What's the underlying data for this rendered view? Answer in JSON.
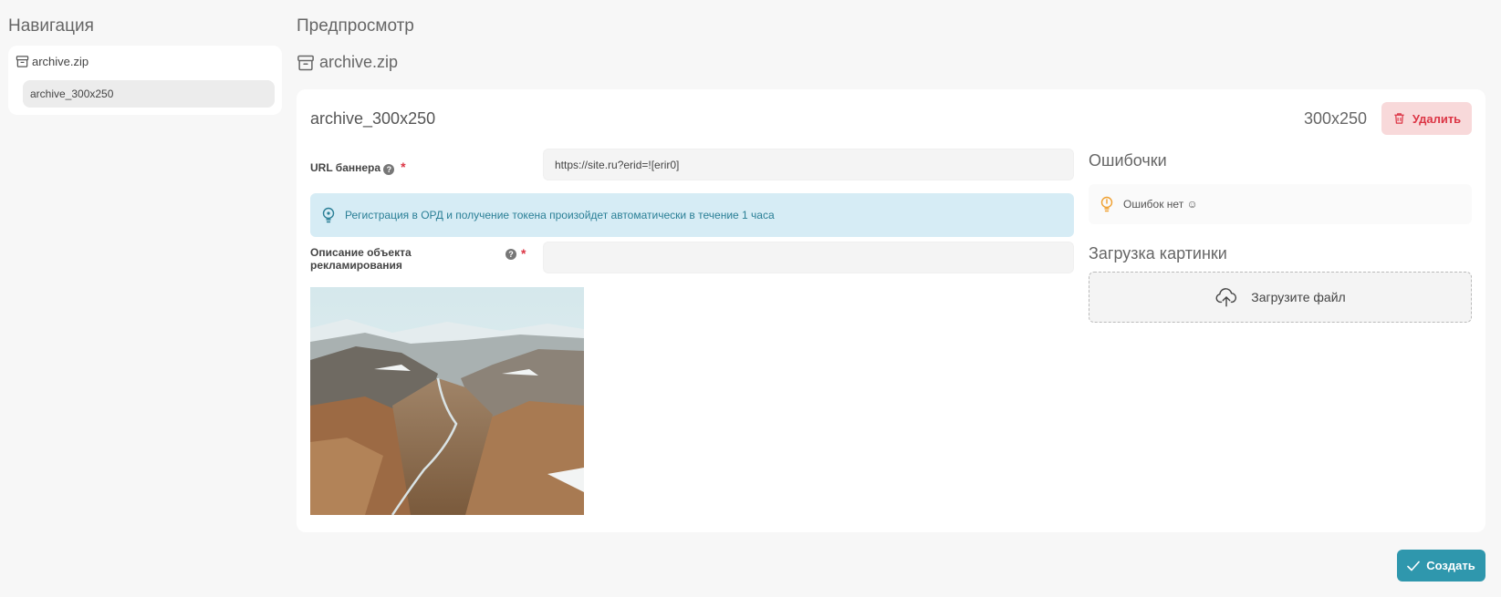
{
  "nav": {
    "title": "Навигация",
    "root": "archive.zip",
    "child": "archive_300x250"
  },
  "preview": {
    "title": "Предпросмотр",
    "archive": "archive.zip"
  },
  "banner": {
    "name": "archive_300x250",
    "size": "300x250",
    "delete_label": "Удалить",
    "url_label": "URL баннера",
    "url_value": "https://site.ru?erid=![erir0]",
    "info": "Регистрация в ОРД и получение токена произойдет автоматически в течение 1 часа",
    "description_label": "Описание объекта рекламирования",
    "description_value": "",
    "required_mark": "*",
    "help_glyph": "?"
  },
  "errors": {
    "title": "Ошибочки",
    "message": "Ошибок нет ☺"
  },
  "upload": {
    "title": "Загрузка картинки",
    "label": "Загрузите файл"
  },
  "actions": {
    "create_label": "Создать"
  },
  "colors": {
    "accent": "#2f97ad",
    "danger": "#dc3545",
    "info_bg": "#d6ecf5",
    "warning_icon": "#f0a030"
  },
  "icons": {
    "archive": "archive-box-icon",
    "delete": "trash-icon",
    "info": "lightbulb-icon",
    "error_status": "lightbulb-icon",
    "upload": "cloud-upload-icon",
    "create": "checkmark-icon"
  }
}
